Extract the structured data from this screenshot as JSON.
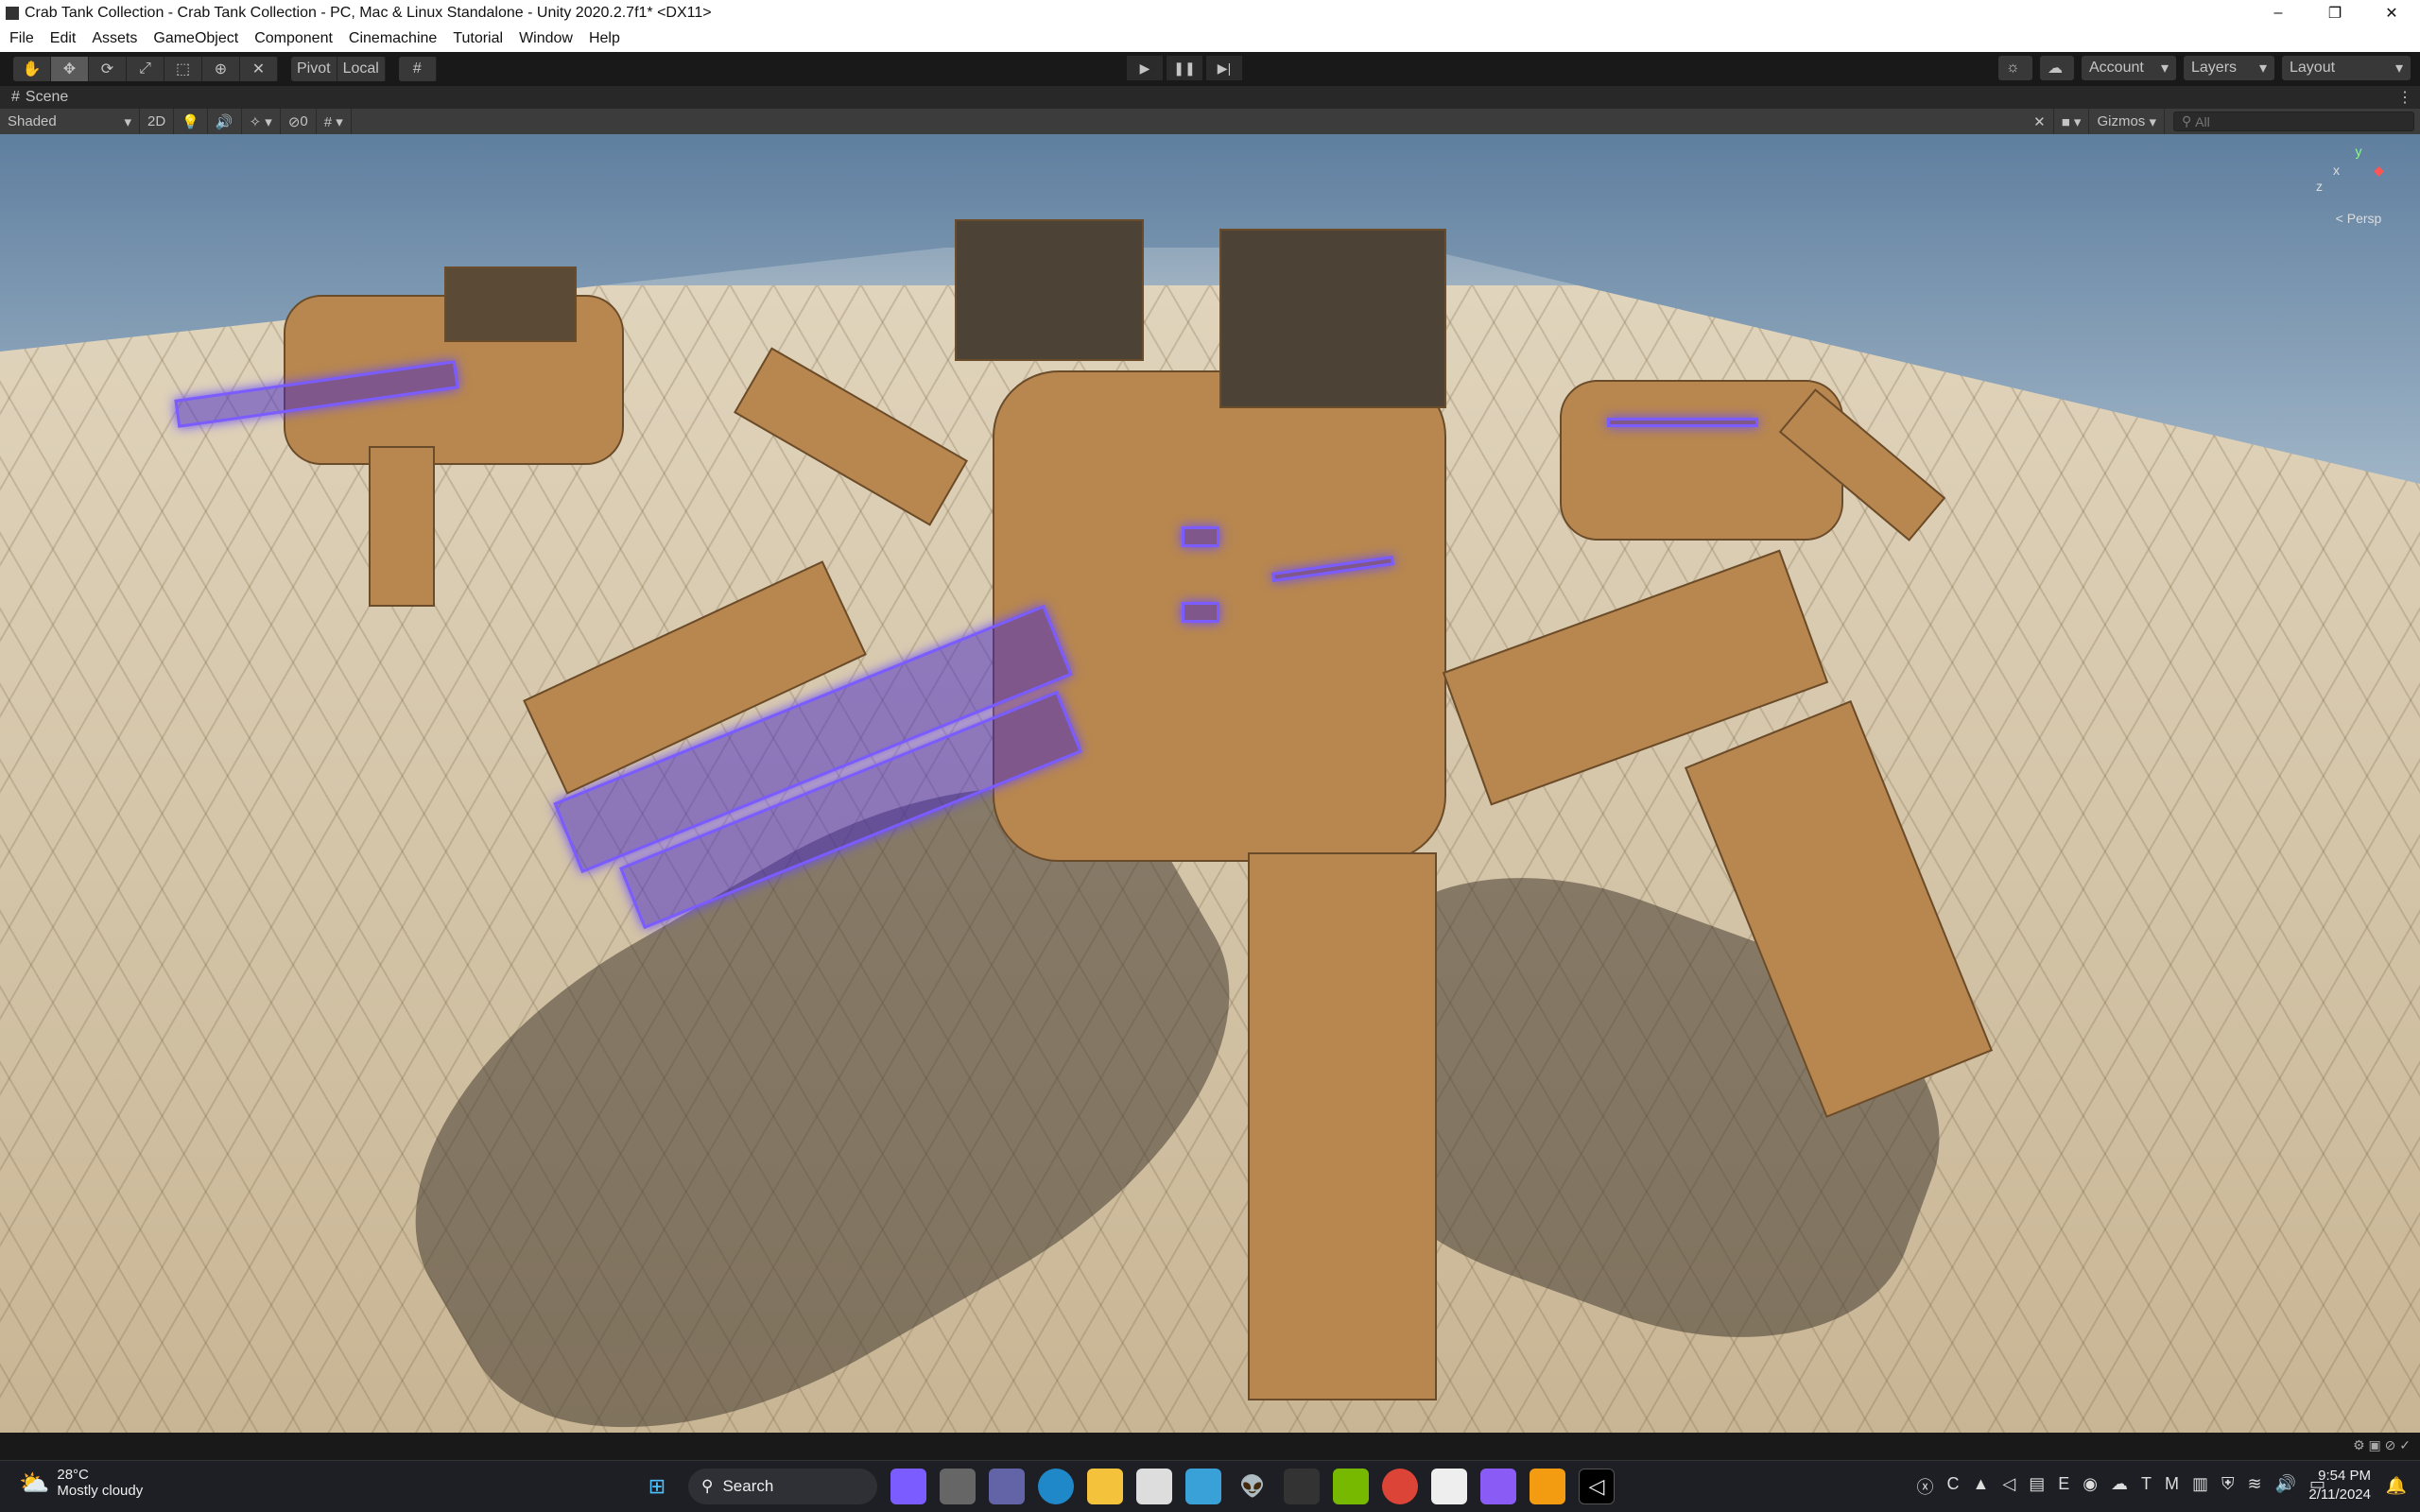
{
  "window": {
    "title": "Crab Tank Collection - Crab Tank Collection - PC, Mac & Linux Standalone - Unity 2020.2.7f1* <DX11>",
    "minimize": "–",
    "maximize": "❐",
    "close": "✕"
  },
  "menu": [
    "File",
    "Edit",
    "Assets",
    "GameObject",
    "Component",
    "Cinemachine",
    "Tutorial",
    "Window",
    "Help"
  ],
  "toolbar": {
    "tools": [
      "✋",
      "✥",
      "⟳",
      "⤢",
      "⬚",
      "⊕",
      "✕"
    ],
    "pivot": "Pivot",
    "local": "Local",
    "snap": "#",
    "play": "▶",
    "pause": "❚❚",
    "step": "▶|",
    "account": "Account",
    "layers": "Layers",
    "layout": "Layout"
  },
  "scene": {
    "tab": "Scene",
    "shading": "Shaded",
    "mode2d": "2D",
    "hidden_count": "0",
    "gizmos": "Gizmos",
    "search_placeholder": "All",
    "persp": "< Persp",
    "axes": {
      "x": "x",
      "y": "y",
      "z": "z"
    }
  },
  "taskbar": {
    "temperature": "28°C",
    "weather": "Mostly cloudy",
    "search": "Search",
    "time": "9:54 PM",
    "date": "2/11/2024"
  }
}
